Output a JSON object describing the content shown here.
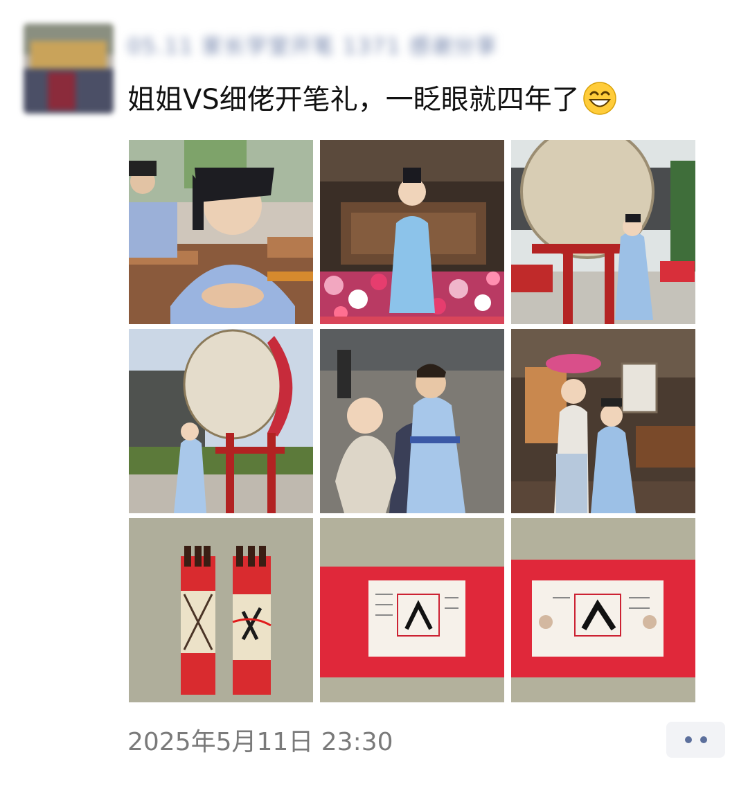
{
  "post": {
    "author_name": "05.11 家长学堂开笔 1371 感谢分享",
    "text": "姐姐VS细佬开笔礼，一眨眼就四年了",
    "emoji": "grinning-face-emoji",
    "timestamp": "2025年5月11日 23:30"
  },
  "photos": [
    {
      "name": "photo-girl-at-desk"
    },
    {
      "name": "photo-girl-with-flowers"
    },
    {
      "name": "photo-girl-with-drum"
    },
    {
      "name": "photo-boy-with-drum"
    },
    {
      "name": "photo-siblings-courtyard"
    },
    {
      "name": "photo-siblings-hall"
    },
    {
      "name": "photo-scrolls-rolled"
    },
    {
      "name": "photo-scroll-ren-1"
    },
    {
      "name": "photo-scroll-ren-2"
    }
  ],
  "colors": {
    "link_blue": "#5c6f9c",
    "text": "#111111",
    "timestamp": "#7a7a7a",
    "hanfu_blue": "#9ec3ea",
    "scroll_red": "#e0283a"
  }
}
